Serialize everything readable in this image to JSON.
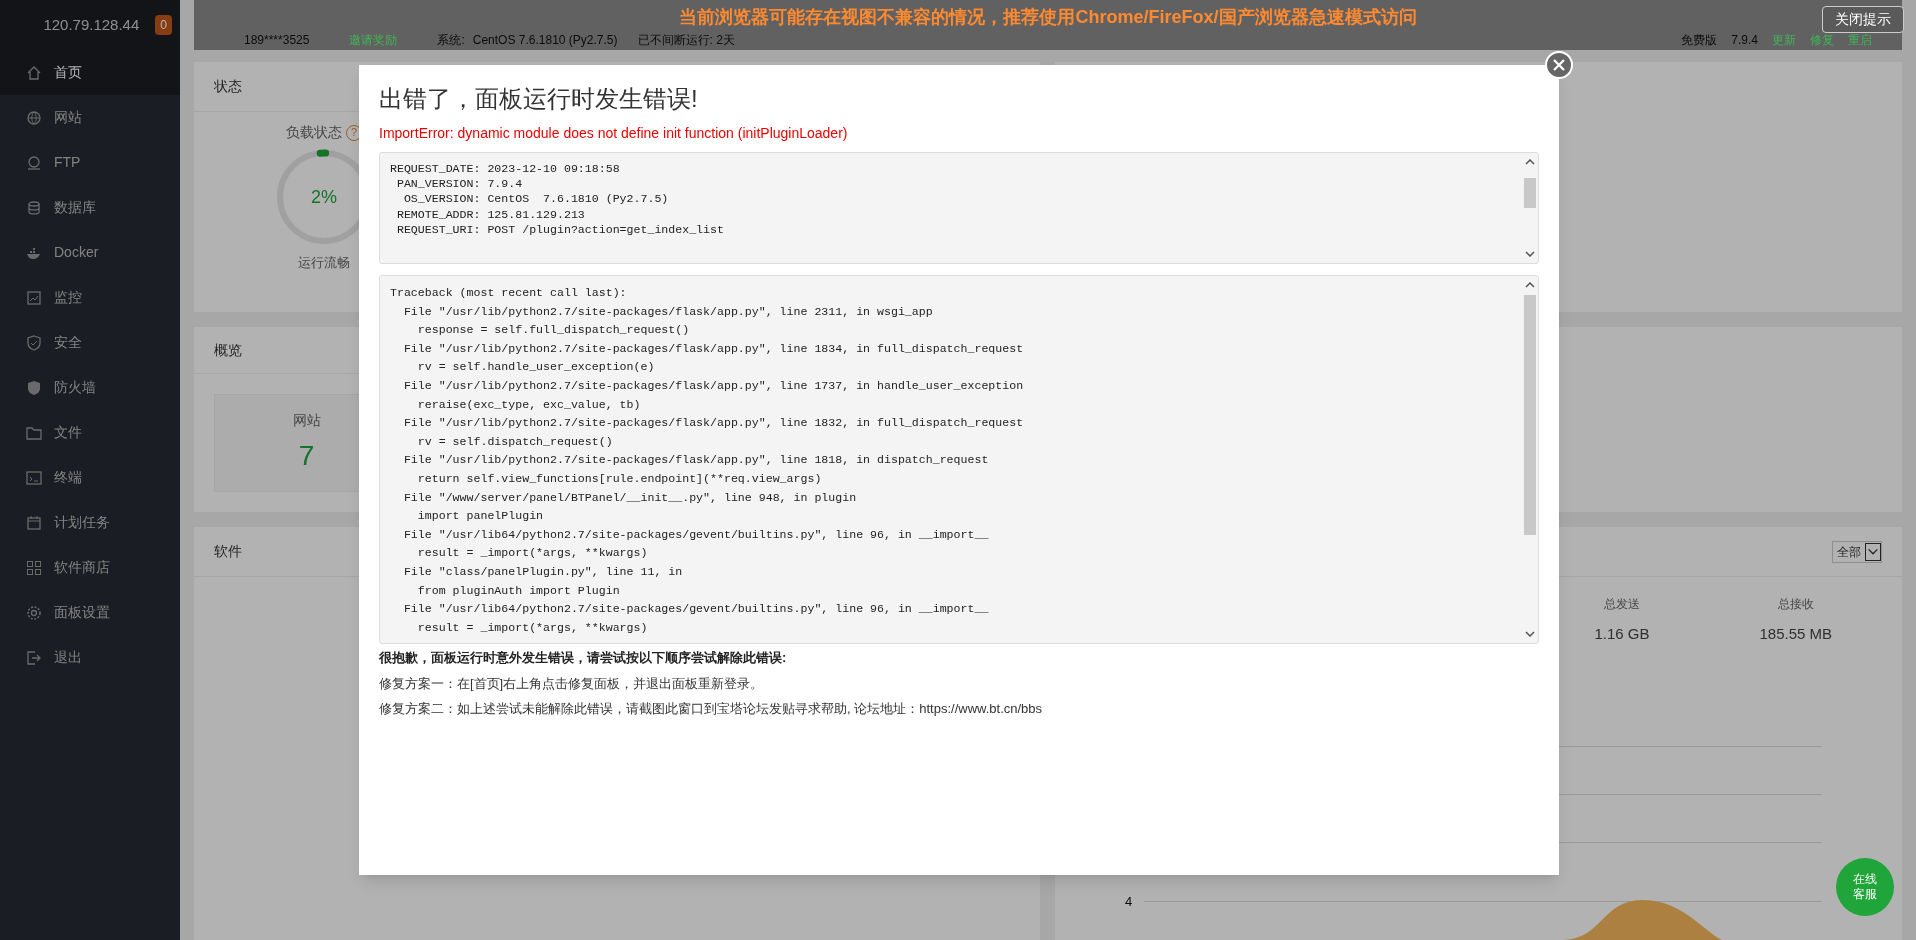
{
  "banner": {
    "text": "当前浏览器可能存在视图不兼容的情况，推荐使用Chrome/FireFox/国产浏览器急速模式访问",
    "close": "关闭提示"
  },
  "sidebar": {
    "server_ip": "120.79.128.44",
    "badge": "0",
    "items": [
      {
        "label": "首页",
        "selected": true
      },
      {
        "label": "网站",
        "selected": false
      },
      {
        "label": "FTP",
        "selected": false
      },
      {
        "label": "数据库",
        "selected": false
      },
      {
        "label": "Docker",
        "selected": false
      },
      {
        "label": "监控",
        "selected": false
      },
      {
        "label": "安全",
        "selected": false
      },
      {
        "label": "防火墙",
        "selected": false
      },
      {
        "label": "文件",
        "selected": false
      },
      {
        "label": "终端",
        "selected": false
      },
      {
        "label": "计划任务",
        "selected": false
      },
      {
        "label": "软件商店",
        "selected": false
      },
      {
        "label": "面板设置",
        "selected": false
      },
      {
        "label": "退出",
        "selected": false
      }
    ]
  },
  "header": {
    "account": "189****3525",
    "invite": "邀请奖励",
    "system_label": "系统:",
    "system": "CentOS 7.6.1810 (Py2.7.5)",
    "uptime": "已不间断运行: 2天",
    "edition": "免费版",
    "version": "7.9.4",
    "actions": [
      "更新",
      "修复",
      "重启"
    ]
  },
  "status_card": {
    "title": "状态",
    "gauge_label": "负载状态",
    "help": "?",
    "level": 0.02,
    "value": "2%",
    "caption": "运行流畅"
  },
  "overview_card": {
    "title": "概览",
    "stats": [
      {
        "label": "网站",
        "value": "7"
      }
    ]
  },
  "software_card": {
    "title": "软件"
  },
  "traffic_card": {
    "filter": "全部",
    "stats": [
      {
        "label": "总发送",
        "value": "1.16 GB"
      },
      {
        "label": "总接收",
        "value": "185.55 MB"
      }
    ],
    "y_tick_labels": [
      "4"
    ]
  },
  "chat_button": "在线客服",
  "error_dialog": {
    "title": "出错了，面板运行时发生错误!",
    "message": "ImportError: dynamic module does not define init function (initPluginLoader)",
    "request_lines": [
      "REQUEST_DATE: 2023-12-10 09:18:58",
      " PAN_VERSION: 7.9.4",
      "  OS_VERSION: CentOS  7.6.1810 (Py2.7.5)",
      " REMOTE_ADDR: 125.81.129.213",
      " REQUEST_URI: POST /plugin?action=get_index_list"
    ],
    "traceback_lines": [
      "Traceback (most recent call last):",
      "  File \"/usr/lib/python2.7/site-packages/flask/app.py\", line 2311, in wsgi_app",
      "    response = self.full_dispatch_request()",
      "  File \"/usr/lib/python2.7/site-packages/flask/app.py\", line 1834, in full_dispatch_request",
      "    rv = self.handle_user_exception(e)",
      "  File \"/usr/lib/python2.7/site-packages/flask/app.py\", line 1737, in handle_user_exception",
      "    reraise(exc_type, exc_value, tb)",
      "  File \"/usr/lib/python2.7/site-packages/flask/app.py\", line 1832, in full_dispatch_request",
      "    rv = self.dispatch_request()",
      "  File \"/usr/lib/python2.7/site-packages/flask/app.py\", line 1818, in dispatch_request",
      "    return self.view_functions[rule.endpoint](**req.view_args)",
      "  File \"/www/server/panel/BTPanel/__init__.py\", line 948, in plugin",
      "    import panelPlugin",
      "  File \"/usr/lib64/python2.7/site-packages/gevent/builtins.py\", line 96, in __import__",
      "    result = _import(*args, **kwargs)",
      "  File \"class/panelPlugin.py\", line 11, in",
      "    from pluginAuth import Plugin",
      "  File \"/usr/lib64/python2.7/site-packages/gevent/builtins.py\", line 96, in __import__",
      "    result = _import(*args, **kwargs)"
    ],
    "help_heading": "很抱歉，面板运行时意外发生错误，请尝试按以下顺序尝试解除此错误:",
    "fixes": [
      "修复方案一：在[首页]右上角点击修复面板，并退出面板重新登录。",
      "修复方案二：如上述尝试未能解除此错误，请截图此窗口到宝塔论坛发贴寻求帮助, 论坛地址：https://www.bt.cn/bbs"
    ]
  }
}
